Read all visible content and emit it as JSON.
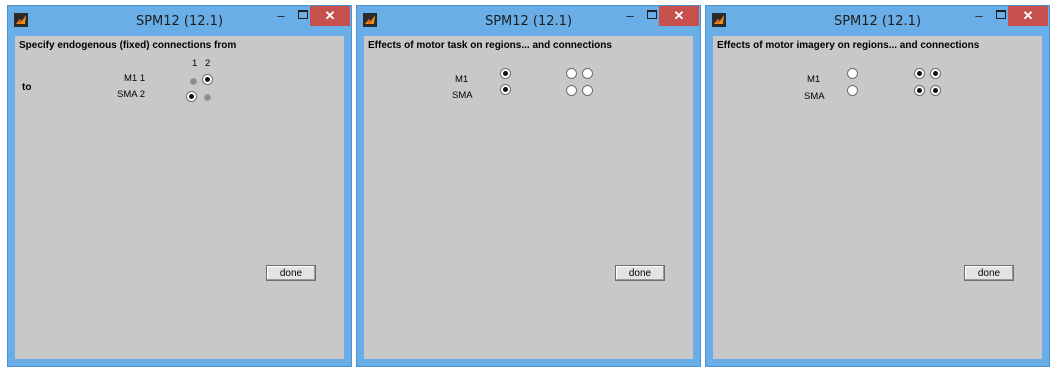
{
  "windows": [
    {
      "title": "SPM12 (12.1)",
      "heading": "Specify endogenous (fixed) connections from",
      "col_header_1": "1",
      "col_header_2": "2",
      "to_label": "to",
      "row_1_label": "M1 1",
      "row_2_label": "SMA 2",
      "done_label": "done"
    },
    {
      "title": "SPM12 (12.1)",
      "heading": "Effects of motor task  on regions... and connections",
      "row_1_label": "M1",
      "row_2_label": "SMA",
      "done_label": "done"
    },
    {
      "title": "SPM12 (12.1)",
      "heading": "Effects of motor imagery on regions... and connections",
      "row_1_label": "M1",
      "row_2_label": "SMA",
      "done_label": "done"
    }
  ],
  "icons": {
    "app": "matlab-logo-icon",
    "minimize": "minimize-icon",
    "maximize": "maximize-icon",
    "close": "close-icon"
  },
  "colors": {
    "title_bar": "#6aaee8",
    "close_button": "#c7504d",
    "client_bg": "#c8c8c8"
  },
  "radio_states": {
    "window_1": {
      "r1c1": false,
      "r1c2": true,
      "r2c1": true,
      "r2c2": false
    },
    "window_2": {
      "m1_region": true,
      "m1_conn_1": false,
      "m1_conn_2": false,
      "sma_region": true,
      "sma_conn_1": false,
      "sma_conn_2": false
    },
    "window_3": {
      "m1_region": false,
      "m1_conn_1": true,
      "m1_conn_2": true,
      "sma_region": false,
      "sma_conn_1": true,
      "sma_conn_2": true
    }
  }
}
